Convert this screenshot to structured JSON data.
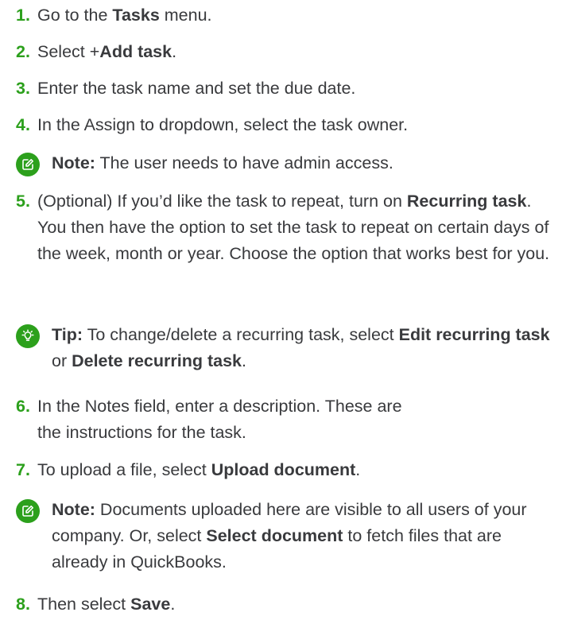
{
  "colors": {
    "accent": "#2ca01c",
    "text": "#393a3d"
  },
  "steps": [
    {
      "num": "1.",
      "parts": [
        "Go to the ",
        "Tasks",
        " menu."
      ]
    },
    {
      "num": "2.",
      "parts": [
        "Select +",
        "Add task",
        "."
      ]
    },
    {
      "num": "3.",
      "parts": [
        "Enter the task name and set the due date."
      ]
    },
    {
      "num": "4.",
      "parts": [
        "In the Assign to dropdown, select the task owner."
      ]
    },
    {
      "num": "5.",
      "parts": [
        "(Optional) If you’d like the task to repeat, turn on ",
        "Recurring task",
        ". You then have the option to set the task to repeat on certain days of the week, month or year. Choose the option that works best for you."
      ]
    },
    {
      "num": "6.",
      "parts": [
        "In the Notes field, enter a description. These are the instructions for the task."
      ]
    },
    {
      "num": "7.",
      "parts": [
        "To upload a file, select ",
        "Upload document",
        "."
      ]
    },
    {
      "num": "8.",
      "parts": [
        "Then select ",
        "Save",
        "."
      ]
    }
  ],
  "callouts": [
    {
      "icon": "note-edit-icon",
      "label": "Note:",
      "parts": [
        "The user needs to have admin access."
      ]
    },
    {
      "icon": "lightbulb-icon",
      "label": "Tip:",
      "parts": [
        "To change/delete a recurring task, select ",
        "Edit recurring task",
        " or ",
        "Delete recurring task",
        "."
      ]
    },
    {
      "icon": "note-edit-icon",
      "label": "Note:",
      "parts": [
        "Documents uploaded here are visible to all users of your company. Or, select ",
        "Select document",
        " to fetch files that are already in QuickBooks."
      ]
    }
  ]
}
